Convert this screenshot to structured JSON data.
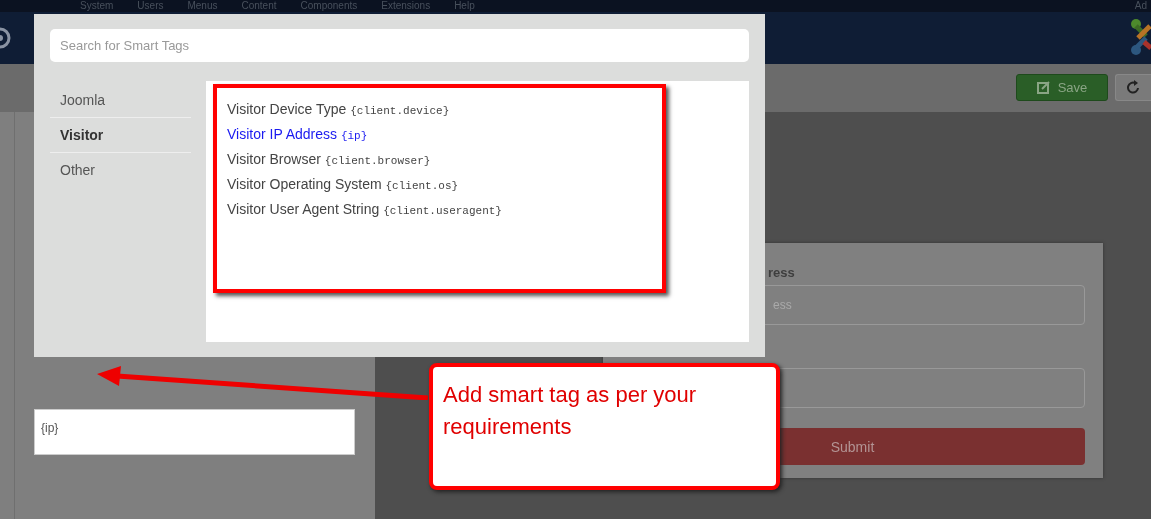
{
  "top_menu": [
    "System",
    "Users",
    "Menus",
    "Content",
    "Components",
    "Extensions",
    "Help"
  ],
  "user_menu": "Ad",
  "toolbar": {
    "save": "Save"
  },
  "editor": {
    "value": "{ip}"
  },
  "form": {
    "fields": [
      {
        "kind": "labeled",
        "label": "ress",
        "placeholder": "ess"
      },
      {
        "kind": "plain"
      }
    ],
    "submit": "Submit"
  },
  "modal": {
    "search": {
      "placeholder": "Search for Smart Tags"
    },
    "categories": [
      {
        "label": "Joomla",
        "selected": false
      },
      {
        "label": "Visitor",
        "selected": true
      },
      {
        "label": "Other",
        "selected": false
      }
    ],
    "tags": [
      {
        "name": "Visitor Device Type",
        "tag": "{client.device}",
        "highlighted": false
      },
      {
        "name": "Visitor IP Address",
        "tag": "{ip}",
        "highlighted": true
      },
      {
        "name": "Visitor Browser",
        "tag": "{client.browser}",
        "highlighted": false
      },
      {
        "name": "Visitor Operating System",
        "tag": "{client.os}",
        "highlighted": false
      },
      {
        "name": "Visitor User Agent String",
        "tag": "{client.useragent}",
        "highlighted": false
      }
    ]
  },
  "callout": {
    "text": "Add smart tag as per your requirements"
  }
}
